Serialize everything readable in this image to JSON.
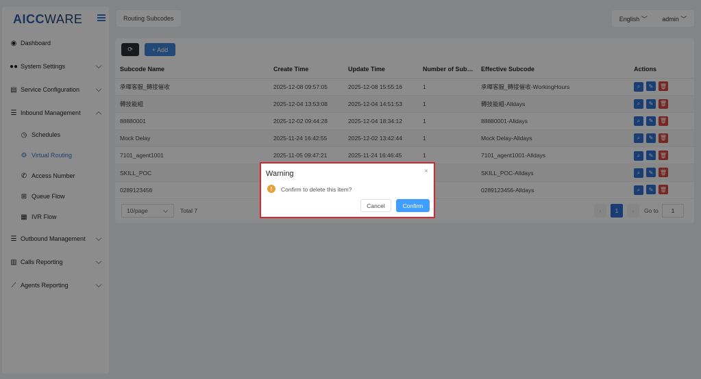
{
  "logo": {
    "part1": "AICC",
    "part2": "WARE"
  },
  "sidebar": {
    "items": [
      {
        "label": "Dashboard",
        "icon": "tachometer-icon"
      },
      {
        "label": "System Settings",
        "icon": "users-icon"
      },
      {
        "label": "Service Configuration",
        "icon": "id-card-icon"
      },
      {
        "label": "Inbound Management",
        "icon": "list-icon"
      },
      {
        "label": "Outbound Management",
        "icon": "list-icon"
      },
      {
        "label": "Calls Reporting",
        "icon": "bar-chart-icon"
      },
      {
        "label": "Agents Reporting",
        "icon": "line-chart-icon"
      }
    ],
    "sub_items": [
      {
        "label": "Schedules",
        "icon": "clock-icon"
      },
      {
        "label": "Virtual Routing",
        "icon": "gear-icon"
      },
      {
        "label": "Access Number",
        "icon": "phone-icon"
      },
      {
        "label": "Queue Flow",
        "icon": "plus-square-icon"
      },
      {
        "label": "IVR Flow",
        "icon": "film-icon"
      }
    ]
  },
  "header": {
    "tab": "Routing Subcodes",
    "language": "English",
    "user": "admin"
  },
  "toolbar": {
    "add_label": "+ Add"
  },
  "table": {
    "headers": [
      "Subcode Name",
      "Create Time",
      "Update Time",
      "Number of Sub…",
      "Effective Subcode",
      "Actions"
    ],
    "rows": [
      [
        "承暉客服_轉接催收",
        "2025-12-08 09:57:05",
        "2025-12-08 15:55:16",
        "1",
        "承暉客服_轉接催收-WorkingHours"
      ],
      [
        "轉技能組",
        "2025-12-04 13:53:08",
        "2025-12-04 14:51:53",
        "1",
        "轉技能組-Alldays"
      ],
      [
        "88880001",
        "2025-12-02 09:44:28",
        "2025-12-04 18:34:12",
        "1",
        "88880001-Alldays"
      ],
      [
        "Mock Delay",
        "2025-11-24 16:42:55",
        "2025-12-02 13:42:44",
        "1",
        "Mock Delay-Alldays"
      ],
      [
        "7101_agent1001",
        "2025-11-05 09:47:21",
        "2025-11-24 16:46:45",
        "1",
        "7101_agent1001-Alldays"
      ],
      [
        "SKILL_POC",
        "",
        "",
        "",
        "SKILL_POC-Alldays"
      ],
      [
        "0289123456",
        "",
        "",
        "",
        "0289123456-Alldays"
      ]
    ]
  },
  "pagination": {
    "page_size": "10/page",
    "total": "Total 7",
    "current_page": "1",
    "goto_label": "Go to",
    "goto_value": "1"
  },
  "dialog": {
    "title": "Warning",
    "message": "Confirm to delete this item?",
    "cancel": "Cancel",
    "confirm": "Confirm",
    "close": "×"
  }
}
